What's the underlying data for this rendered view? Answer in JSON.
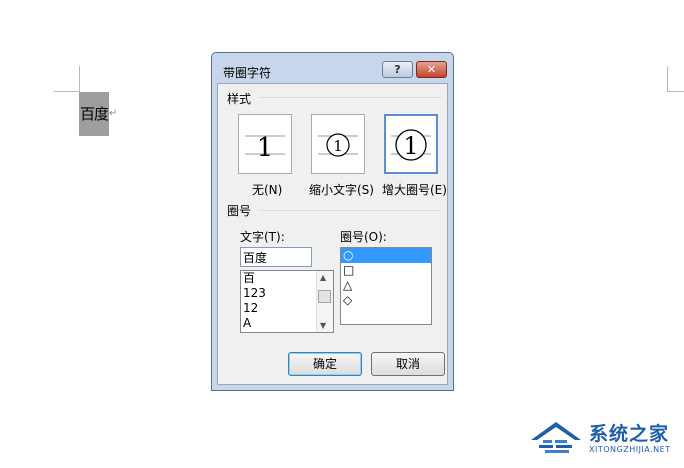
{
  "document": {
    "selected_text": "百度",
    "paragraph_mark": "↵"
  },
  "dialog": {
    "title": "带圈字符",
    "help_label": "?",
    "close_label": "✕",
    "style_group_label": "样式",
    "styles": [
      {
        "label": "无(N)",
        "glyph": "1",
        "enclosure": "none"
      },
      {
        "label": "缩小文字(S)",
        "glyph": "1",
        "enclosure": "circle-shrink-text"
      },
      {
        "label": "增大圈号(E)",
        "glyph": "1",
        "enclosure": "circle-enlarge-symbol",
        "selected": true
      }
    ],
    "enclosure_group_label": "圈号",
    "text_label": "文字(T):",
    "text_value": "百度",
    "text_options": [
      "百",
      "123",
      "12",
      "A"
    ],
    "symbol_label": "圈号(O):",
    "symbol_options": [
      "○",
      "□",
      "△",
      "◇"
    ],
    "symbol_selected": "○",
    "ok_label": "确定",
    "cancel_label": "取消"
  },
  "watermark": {
    "brand": "系统之家",
    "url": "XITONGZHIJIA.NET"
  },
  "colors": {
    "dialog_frame": "#c7d6ea",
    "selection": "#3399ff",
    "close_button": "#c2452b",
    "watermark": "#1f5ea8"
  }
}
